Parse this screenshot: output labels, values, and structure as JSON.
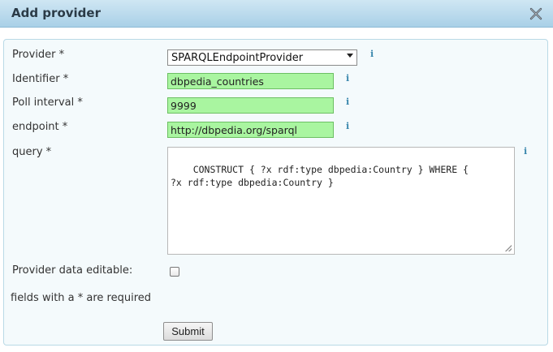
{
  "dialog": {
    "title": "Add provider",
    "close_icon": "close-icon"
  },
  "form": {
    "provider_label": "Provider *",
    "provider_value": "SPARQLEndpointProvider",
    "identifier_label": "Identifier *",
    "identifier_value": "dbpedia_countries",
    "poll_label": "Poll interval *",
    "poll_value": "9999",
    "endpoint_label": "endpoint *",
    "endpoint_value": "http://dbpedia.org/sparql",
    "query_label": "query *",
    "query_value": "CONSTRUCT { ?x rdf:type dbpedia:Country } WHERE {\n?x rdf:type dbpedia:Country }",
    "editable_label": "Provider data editable:",
    "editable_checked": false,
    "required_note": "fields with a * are required",
    "info_glyph": "i",
    "submit_label": "Submit"
  },
  "colors": {
    "titlebar": "#a9d0e7",
    "valid_field": "#a9f5a0",
    "info_icon": "#3a87ad"
  }
}
